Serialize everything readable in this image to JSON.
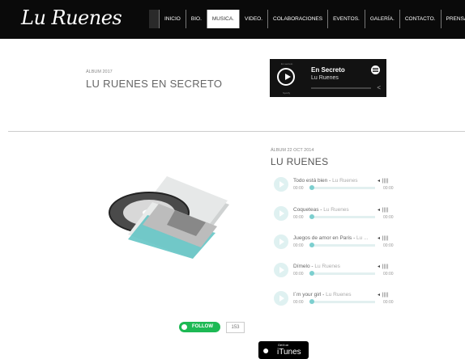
{
  "header": {
    "logo": "Lu Ruenes",
    "nav": [
      {
        "label": "INICIO"
      },
      {
        "label": "BIO."
      },
      {
        "label": "MUSICA."
      },
      {
        "label": "VIDEO."
      },
      {
        "label": "COLABORACIONES"
      },
      {
        "label": "EVENTOS."
      },
      {
        "label": "GALERÍA."
      },
      {
        "label": "CONTACTO."
      },
      {
        "label": "PRENSA."
      }
    ],
    "active_index": 2
  },
  "top_album": {
    "label": "ÁLBUM 2017",
    "title": "LU RUENES EN SECRETO"
  },
  "spotify_player": {
    "track": "En Secreto",
    "artist": "Lu Ruenes",
    "tiny_top": "En secreto",
    "tiny_bottom": "Spotify"
  },
  "album": {
    "label": "ÁLBUM 22 OCT 2014",
    "title": "LU RUENES",
    "tracks": [
      {
        "title": "Todo está bien",
        "artist": "Lu Ruenes",
        "time": "00:00",
        "duration": "00:00"
      },
      {
        "title": "Coqueteas",
        "artist": "Lu Ruenes",
        "time": "00:00",
        "duration": "00:00"
      },
      {
        "title": "Juegos de amor en Paris",
        "artist": "Lu ...",
        "time": "00:00",
        "duration": "00:00"
      },
      {
        "title": "Dímelo",
        "artist": "Lu Ruenes",
        "time": "00:00",
        "duration": "00:00"
      },
      {
        "title": "I´m your girl",
        "artist": "Lu Ruenes",
        "time": "00:00",
        "duration": "00:00"
      }
    ]
  },
  "follow": {
    "label": "FOLLOW",
    "count": "153"
  },
  "itunes": {
    "small": "Get it on",
    "big": "iTunes"
  },
  "colors": {
    "accent": "#7ccfcf",
    "spotify_green": "#1db954",
    "header_bg": "#0a0a0a"
  }
}
